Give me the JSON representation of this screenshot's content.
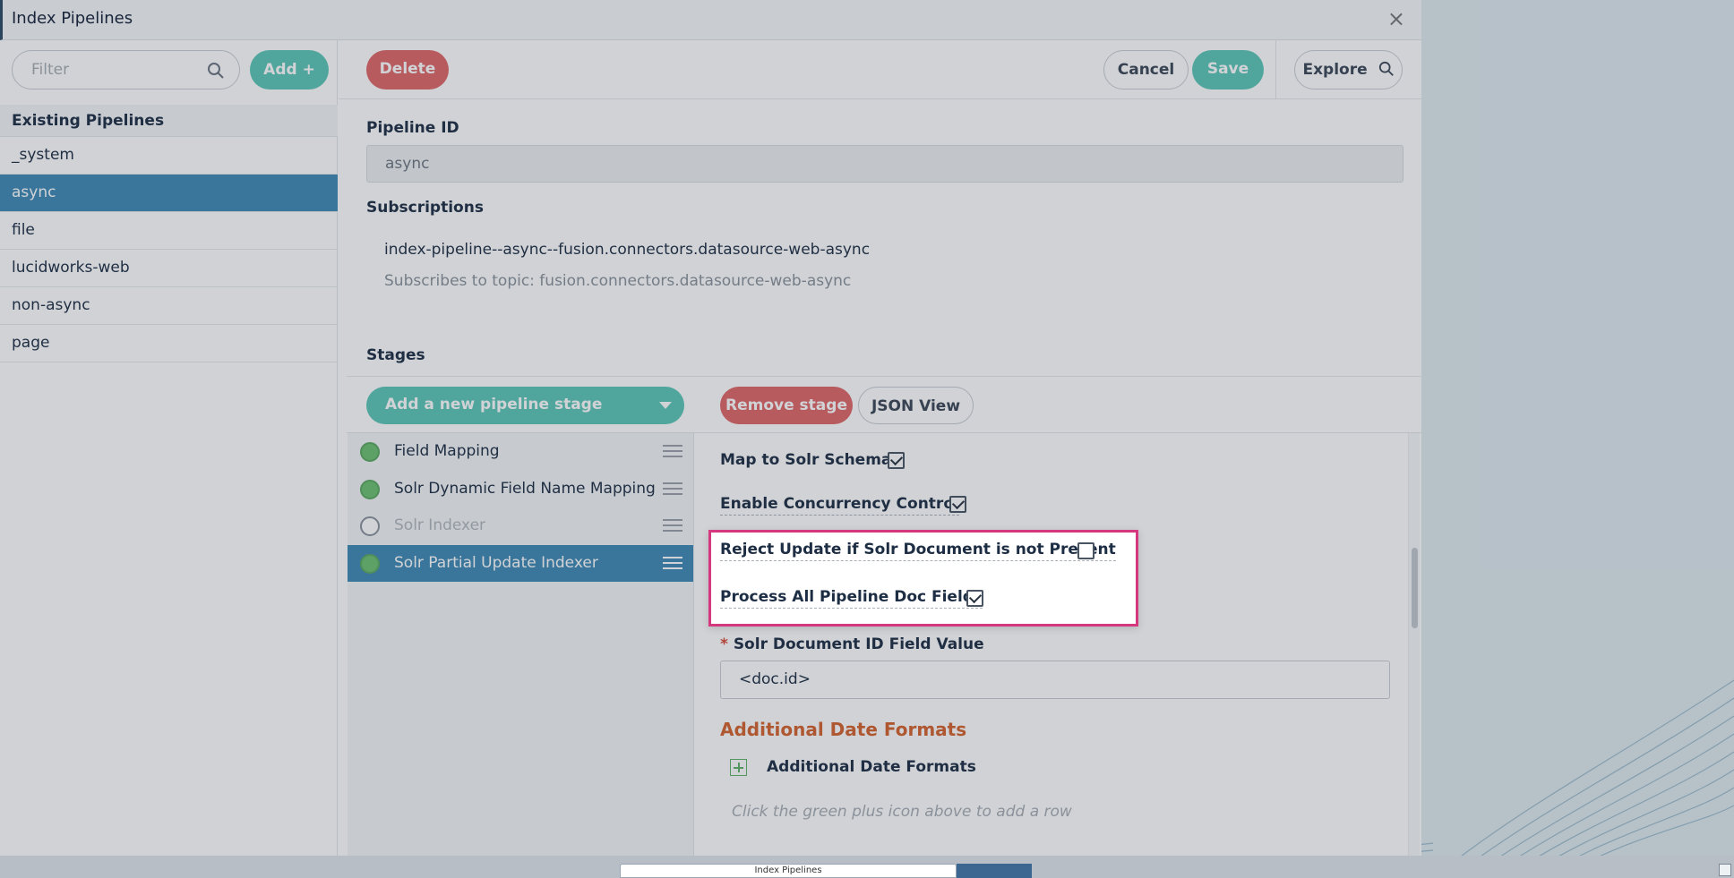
{
  "window": {
    "title": "Index Pipelines",
    "close_glyph": "×"
  },
  "sidebar": {
    "filter_placeholder": "Filter",
    "add_label": "Add +",
    "section_title": "Existing Pipelines",
    "pipelines": [
      "_system",
      "async",
      "file",
      "lucidworks-web",
      "non-async",
      "page"
    ],
    "selected": "async"
  },
  "toolbar": {
    "delete_label": "Delete",
    "cancel_label": "Cancel",
    "save_label": "Save",
    "explore_label": "Explore"
  },
  "pipeline": {
    "id_label": "Pipeline ID",
    "id_value": "async",
    "subscriptions_label": "Subscriptions",
    "subscription_name": "index-pipeline--async--fusion.connectors.datasource-web-async",
    "subscription_topic": "Subscribes to topic: fusion.connectors.datasource-web-async"
  },
  "stages": {
    "title": "Stages",
    "add_stage_label": "Add a new pipeline stage",
    "remove_stage_label": "Remove stage",
    "json_view_label": "JSON View",
    "items": [
      {
        "name": "Field Mapping",
        "enabled": true
      },
      {
        "name": "Solr Dynamic Field Name Mapping",
        "enabled": true
      },
      {
        "name": "Solr Indexer",
        "enabled": false
      },
      {
        "name": "Solr Partial Update Indexer",
        "enabled": true
      }
    ],
    "selected": "Solr Partial Update Indexer"
  },
  "form": {
    "map_to_solr_label": "Map to Solr Schema",
    "map_to_solr_checked": true,
    "concurrency_label": "Enable Concurrency Control",
    "concurrency_checked": true,
    "reject_label": "Reject Update if Solr Document is not Present",
    "reject_checked": false,
    "process_all_label": "Process All Pipeline Doc Fields",
    "process_all_checked": true,
    "doc_id_required": "*",
    "doc_id_label": "Solr Document ID Field Value",
    "doc_id_value": "<doc.id>",
    "date_formats_section": "Additional Date Formats",
    "date_formats_label": "Additional Date Formats",
    "date_formats_hint": "Click the green plus icon above to add a row"
  },
  "taskbar": {
    "item_label": "Index Pipelines"
  },
  "colors": {
    "accent_teal": "#5cc7b8",
    "danger": "#e06767",
    "selected_blue": "#3f8ab5",
    "highlight": "#d6387f",
    "section_orange": "#d5622d"
  }
}
